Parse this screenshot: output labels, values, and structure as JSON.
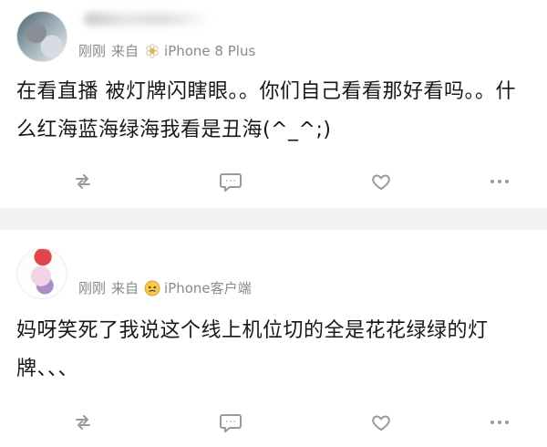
{
  "colors": {
    "background": "#f1f1f3",
    "card": "#ffffff",
    "text": "#171717",
    "meta": "#8a8a8a",
    "icon": "#9a9a9a"
  },
  "posts": [
    {
      "meta": {
        "time": "刚刚",
        "from_label": "来自",
        "source": "iPhone 8 Plus",
        "source_icon": "flower-icon"
      },
      "content": "在看直播 被灯牌闪瞎眼。。你们自己看看那好看吗。。什么红海蓝海绿海我看是丑海(^_^;)",
      "actions": [
        "repost-icon",
        "comment-icon",
        "like-icon",
        "more-icon"
      ]
    },
    {
      "meta": {
        "time": "刚刚",
        "from_label": "来自",
        "source": "iPhone客户端",
        "source_icon": "sad-face-icon"
      },
      "content": "妈呀笑死了我说这个线上机位切的全是花花绿绿的灯牌、、、",
      "actions": [
        "repost-icon",
        "comment-icon",
        "like-icon",
        "more-icon"
      ]
    }
  ]
}
